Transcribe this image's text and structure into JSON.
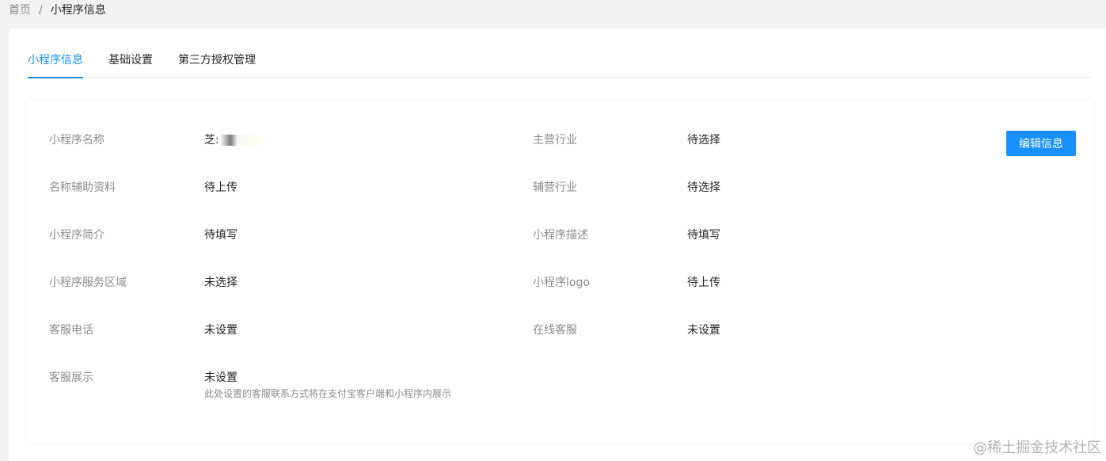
{
  "breadcrumb": {
    "home": "首页",
    "separator": "/",
    "current": "小程序信息"
  },
  "tabs": [
    {
      "label": "小程序信息",
      "active": true
    },
    {
      "label": "基础设置",
      "active": false
    },
    {
      "label": "第三方授权管理",
      "active": false
    }
  ],
  "info": {
    "name_label": "小程序名称",
    "name_value": "芝:",
    "industry_label": "主营行业",
    "industry_value": "待选择",
    "name_aux_label": "名称辅助资料",
    "name_aux_value": "待上传",
    "sub_industry_label": "辅营行业",
    "sub_industry_value": "待选择",
    "intro_label": "小程序简介",
    "intro_value": "待填写",
    "desc_label": "小程序描述",
    "desc_value": "待填写",
    "region_label": "小程序服务区域",
    "region_value": "未选择",
    "logo_label": "小程序logo",
    "logo_value": "待上传",
    "phone_label": "客服电话",
    "phone_value": "未设置",
    "online_cs_label": "在线客服",
    "online_cs_value": "未设置",
    "cs_display_label": "客服展示",
    "cs_display_value": "未设置",
    "cs_display_hint": "此处设置的客服联系方式将在支付宝客户端和小程序内展示"
  },
  "edit_button": "编辑信息",
  "watermark": "@稀土掘金技术社区",
  "colors": {
    "accent": "#1890ff",
    "background": "#f2f2f2"
  }
}
